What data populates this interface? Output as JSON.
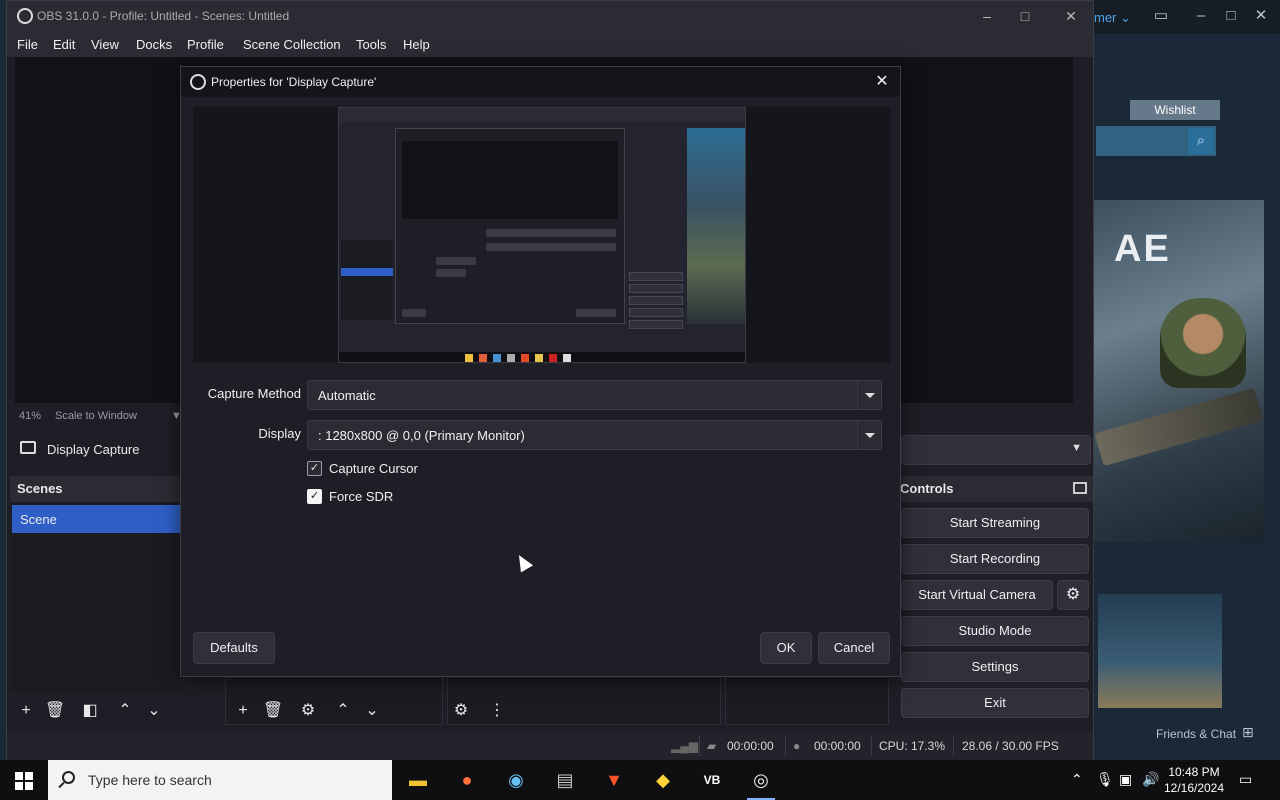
{
  "steam": {
    "user_label": "mer ⌄",
    "wishlist_label": "Wishlist",
    "hero_text": "AE",
    "friends_label": "Friends & Chat"
  },
  "obs": {
    "title": "OBS 31.0.0 - Profile: Untitled - Scenes: Untitled",
    "menu": [
      "File",
      "Edit",
      "View",
      "Docks",
      "Profile",
      "Scene Collection",
      "Tools",
      "Help"
    ],
    "zoom_percent": "41%",
    "zoom_mode": "Scale to Window",
    "source_label": "Display Capture",
    "scenes_header": "Scenes",
    "scenes": [
      {
        "label": "Scene",
        "selected": true
      }
    ],
    "controls_header": "Controls",
    "controls": {
      "start_streaming": "Start Streaming",
      "start_recording": "Start Recording",
      "start_virtual_camera": "Start Virtual Camera",
      "studio_mode": "Studio Mode",
      "settings": "Settings",
      "exit": "Exit"
    },
    "status": {
      "stream_time": "00:00:00",
      "record_time": "00:00:00",
      "cpu": "CPU: 17.3%",
      "fps": "28.06 / 30.00 FPS"
    }
  },
  "dialog": {
    "title": "Properties for 'Display Capture'",
    "capture_method_label": "Capture Method",
    "capture_method_value": "Automatic",
    "display_label": "Display",
    "display_value": ": 1280x800 @ 0,0 (Primary Monitor)",
    "capture_cursor_label": "Capture Cursor",
    "capture_cursor_checked": true,
    "force_sdr_label": "Force SDR",
    "force_sdr_checked": true,
    "defaults_label": "Defaults",
    "ok_label": "OK",
    "cancel_label": "Cancel"
  },
  "taskbar": {
    "search_placeholder": "Type here to search",
    "time": "10:48 PM",
    "date": "12/16/2024",
    "apps": [
      "file-explorer-icon",
      "firefox-icon",
      "steam-icon",
      "app-icon",
      "brave-icon",
      "python-icon",
      "virtualbox-icon",
      "obs-icon"
    ]
  }
}
